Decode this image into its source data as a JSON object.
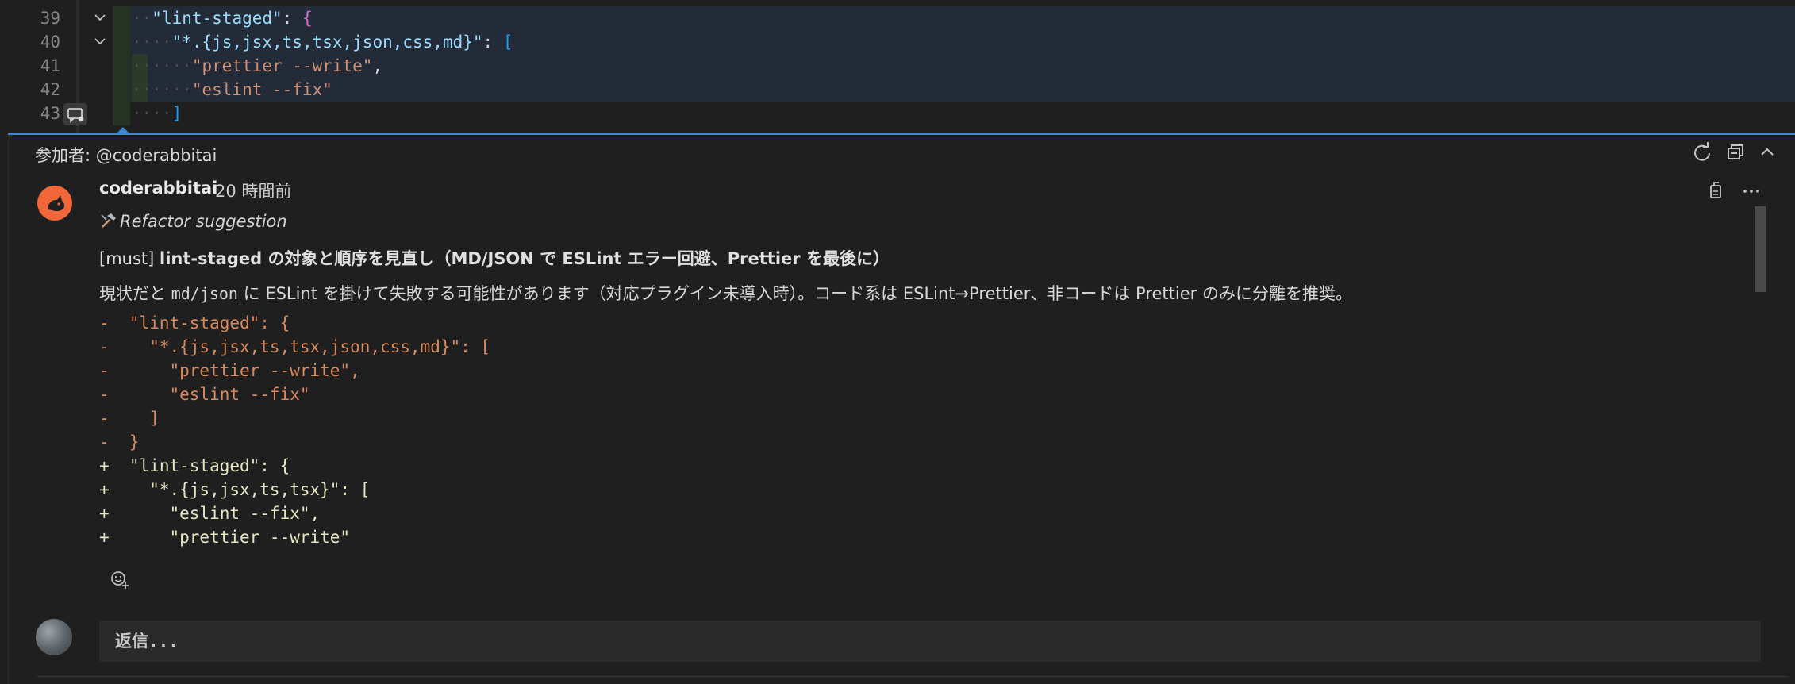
{
  "editor": {
    "lines": [
      {
        "num": "39",
        "key": "\"lint-staged\"",
        "rest": ": ",
        "brace": "{"
      },
      {
        "num": "40",
        "key": "\"*.{js,jsx,ts,tsx,json,css,md}\"",
        "rest": ": ",
        "brace": "["
      },
      {
        "num": "41",
        "str": "\"prettier --write\"",
        "rest": ","
      },
      {
        "num": "42",
        "str": "\"eslint --fix\""
      },
      {
        "num": "43",
        "brace": "]"
      }
    ]
  },
  "comment_thread": {
    "participants_label": "参加者: @coderabbitai",
    "author": "coderabbitai",
    "time_ago": "20 時間前",
    "refactor_label": "Refactor suggestion",
    "must_prefix": "[must]",
    "must_title": "lint-staged の対象と順序を見直し（MD/JSON で ESLint エラー回避、Prettier を最後に）",
    "description": {
      "part1": "現状だと ",
      "code": "md/json",
      "part2": " に ESLint を掛けて失敗する可能性があります（対応プラグイン未導入時）。コード系は ESLint→Prettier、非コードは Prettier のみに分離を推奨。"
    },
    "diff": [
      "-  \"lint-staged\": {",
      "-    \"*.{js,jsx,ts,tsx,json,css,md}\": [",
      "-      \"prettier --write\",",
      "-      \"eslint --fix\"",
      "-    ]",
      "-  }",
      "+  \"lint-staged\": {",
      "+    \"*.{js,jsx,ts,tsx}\": [",
      "+      \"eslint --fix\",",
      "+      \"prettier --write\""
    ],
    "reply_placeholder": "返信..."
  },
  "icons": {
    "refresh": "refresh-icon",
    "collapse_all": "collapse-all-icon",
    "chevron_up": "chevron-up-icon",
    "copy": "copy-icon",
    "more": "more-icon",
    "add_reaction": "add-reaction-icon",
    "refactor": "hammer-icon",
    "comment_gutter": "comment-gutter-icon"
  },
  "colors": {
    "accent": "#3f86d4",
    "diff_minus": "#d88a5e",
    "diff_plus": "#e6e6c4",
    "json_key": "#9cdcfe",
    "json_string": "#ce9178",
    "avatar_bot": "#f1673a"
  }
}
